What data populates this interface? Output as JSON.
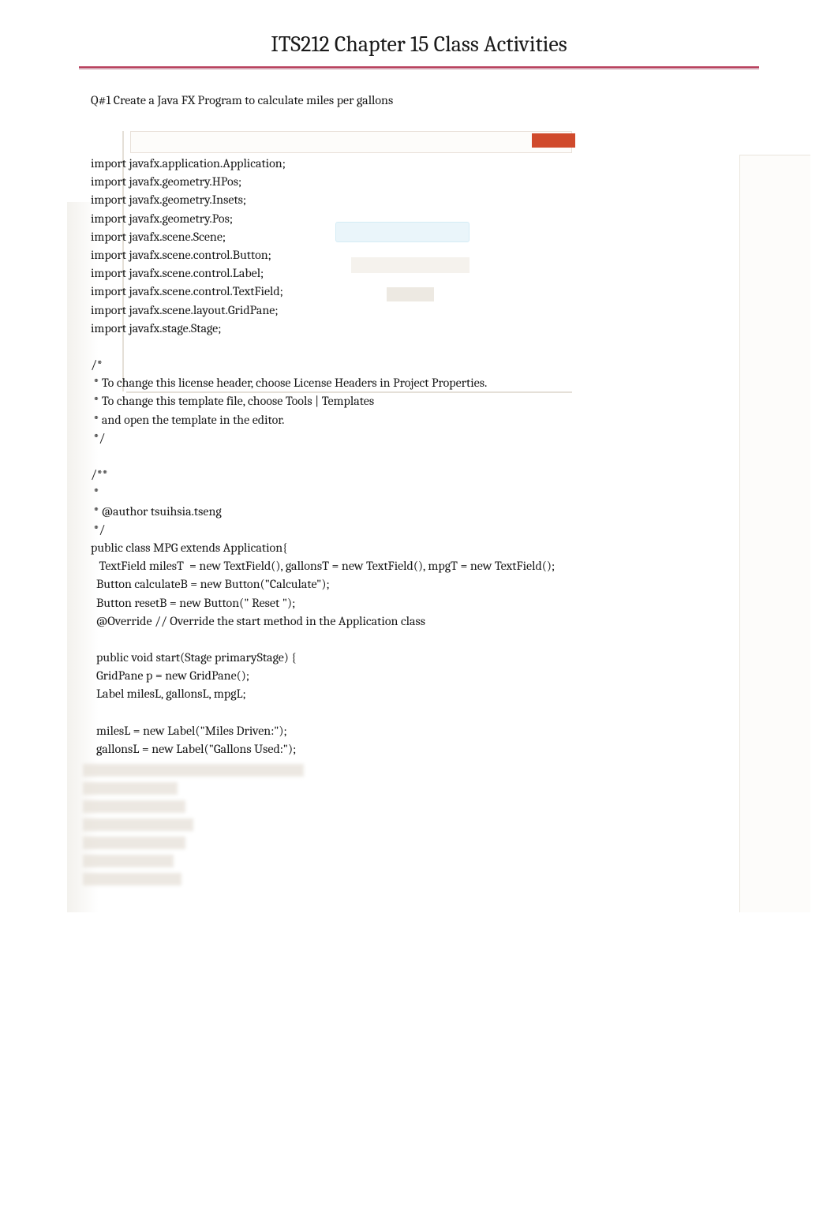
{
  "title": "ITS212 Chapter 15 Class Activities",
  "question": "Q#1 Create a Java FX Program to calculate miles per gallons",
  "code": "import javafx.application.Application;\nimport javafx.geometry.HPos;\nimport javafx.geometry.Insets;\nimport javafx.geometry.Pos;\nimport javafx.scene.Scene;\nimport javafx.scene.control.Button;\nimport javafx.scene.control.Label;\nimport javafx.scene.control.TextField;\nimport javafx.scene.layout.GridPane;\nimport javafx.stage.Stage;\n\n/*\n * To change this license header, choose License Headers in Project Properties.\n * To change this template file, choose Tools | Templates\n * and open the template in the editor.\n */\n\n/**\n *\n * @author tsuihsia.tseng\n */\npublic class MPG extends Application{\n   TextField milesT  = new TextField(), gallonsT = new TextField(), mpgT = new TextField();\n  Button calculateB = new Button(\"Calculate\");\n  Button resetB = new Button(\" Reset \");\n  @Override // Override the start method in the Application class\n\n  public void start(Stage primaryStage) {\n  GridPane p = new GridPane();\n  Label milesL, gallonsL, mpgL;\n\n  milesL = new Label(\"Miles Driven:\");\n  gallonsL = new Label(\"Gallons Used:\");"
}
